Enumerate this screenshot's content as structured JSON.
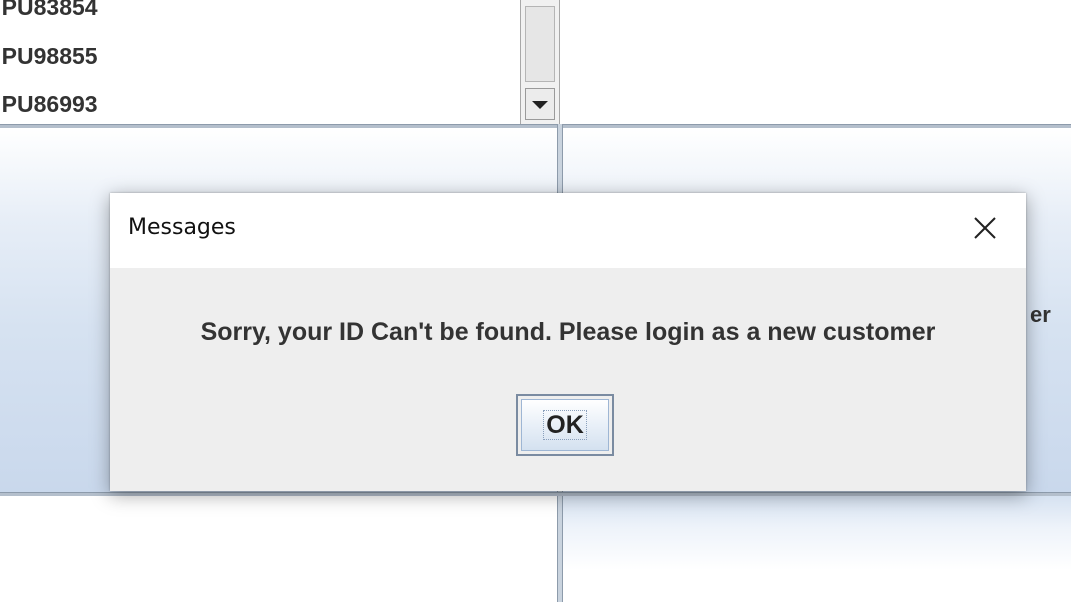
{
  "list": {
    "items": [
      {
        "label": ":PU83854"
      },
      {
        "label": ":PU98855"
      },
      {
        "label": ":PU86993"
      }
    ]
  },
  "background": {
    "partial_text": "er"
  },
  "dialog": {
    "title": "Messages",
    "close_icon": "close-icon",
    "message": "Sorry, your ID Can't be found. Please login as a new customer",
    "ok_label": "OK"
  },
  "colors": {
    "panel_gradient": "#d6e2f1",
    "separator": "#8d9bab",
    "dialog_bg": "#eeeeee",
    "text": "#333333"
  }
}
